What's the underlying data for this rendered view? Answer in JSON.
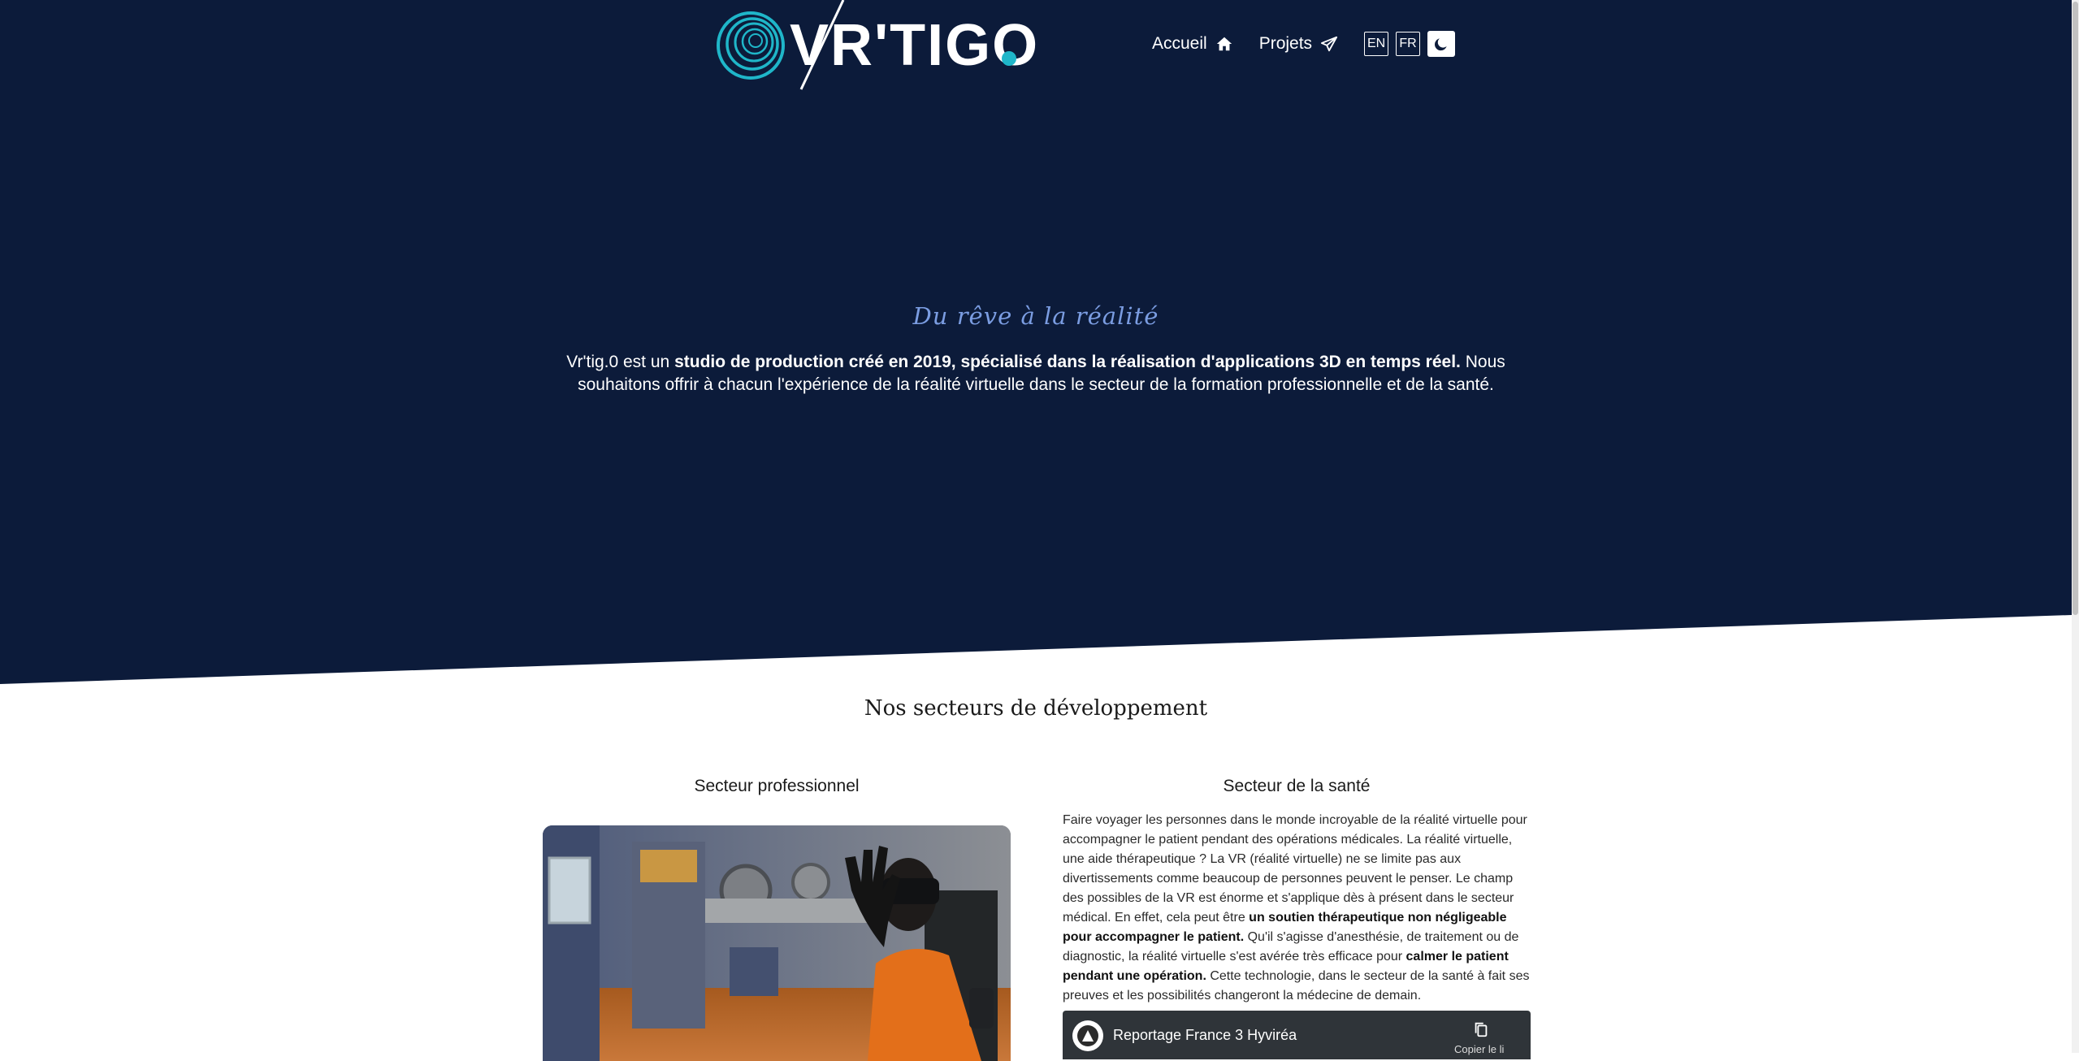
{
  "header": {
    "logo_text": "VR'TIGO",
    "nav": [
      {
        "label": "Accueil",
        "icon": "home-icon"
      },
      {
        "label": "Projets",
        "icon": "send-icon"
      }
    ],
    "languages": [
      "EN",
      "FR"
    ],
    "theme_toggle_icon": "moon-icon"
  },
  "hero": {
    "tagline": "Du rêve à la réalité",
    "intro_parts": [
      "Vr'tig.0 est un ",
      "studio de production créé en 2019, spécialisé dans la réalisation d'applications 3D en temps réel.",
      " Nous souhaitons offrir à chacun l'expérience de la réalité virtuelle dans le secteur de la formation professionnelle et de la santé."
    ]
  },
  "sectors": {
    "title": "Nos secteurs de développement",
    "professional": {
      "title": "Secteur professionnel",
      "image_alt": "personne avec casque de réalité virtuelle dans un atelier virtuel"
    },
    "health": {
      "title": "Secteur de la santé",
      "text_parts": [
        "Faire voyager les personnes dans le monde incroyable de la réalité virtuelle pour accompagner le patient pendant des opérations médicales. La réalité virtuelle, une aide thérapeutique ? La VR (réalité virtuelle) ne se limite pas aux divertissements comme beaucoup de personnes peuvent le penser. Le champ des possibles de la VR est énorme et s'applique dès à présent dans le secteur médical. En effet, cela peut être ",
        "un soutien thérapeutique non négligeable pour accompagner le patient.",
        " Qu'il s'agisse d'anesthésie, de traitement ou de diagnostic, la réalité virtuelle s'est avérée très efficace pour ",
        "calmer le patient pendant une opération.",
        " Cette technologie, dans le secteur de la santé à fait ses preuves et les possibilités changeront la médecine de demain."
      ],
      "video": {
        "title": "Reportage France 3 Hyviréa",
        "copy_label": "Copier le li"
      }
    }
  },
  "colors": {
    "hero_bg": "#0c1b3a",
    "tagline": "#7b9de2",
    "logo_accent": "#1fb6c9"
  }
}
